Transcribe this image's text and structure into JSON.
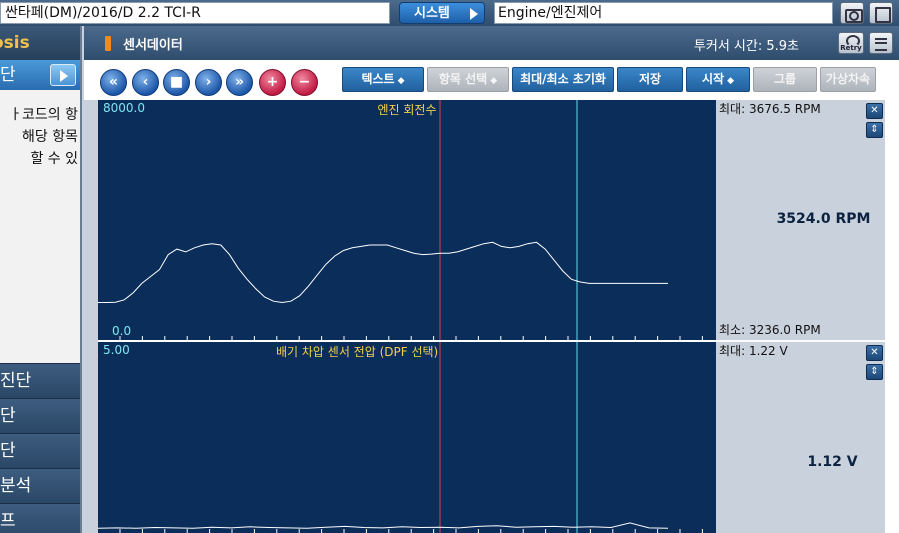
{
  "topbar": {
    "vehicle": "싼타페(DM)/2016/D 2.2 TCI-R",
    "system_button": "시스템",
    "system_field": "Engine/엔진제어"
  },
  "sidebar": {
    "title": "osis",
    "active_item": "단",
    "description": "ㅏ코드의 항\n해당 항목\n할 수 있",
    "items": [
      "진단",
      "단",
      "단",
      "분석",
      "프"
    ]
  },
  "header": {
    "title": "센서데이터",
    "trigger_time": "투커서 시간: 5.9초",
    "retry_label": "Retry"
  },
  "toolbar": {
    "text_label": "텍스트",
    "item_select_label": "항목 선택",
    "reset_minmax_label": "최대/최소 초기화",
    "save_label": "저장",
    "start_label": "시작",
    "graph_label": "그룹",
    "virtual_label": "가상차속"
  },
  "chart_data": [
    {
      "type": "line",
      "title": "엔진 회전수",
      "ylim": [
        0,
        8000
      ],
      "y_max_label": "8000.0",
      "y_min_label": "0.0",
      "x": [
        0,
        1,
        2,
        3,
        4,
        5,
        6,
        7,
        8,
        9,
        10,
        11,
        12,
        13,
        14,
        15,
        16,
        17,
        18,
        19,
        20,
        21,
        22,
        23,
        24,
        25,
        26,
        27,
        28,
        29,
        30,
        31,
        32,
        33,
        34,
        35,
        36,
        37,
        38,
        39,
        40,
        41,
        42,
        43,
        44,
        45,
        46,
        47,
        48,
        49,
        50,
        51,
        52,
        53,
        54,
        55,
        56,
        57,
        58,
        59,
        60,
        61,
        62,
        63,
        64,
        65
      ],
      "values": [
        1150,
        1150,
        1160,
        1250,
        1500,
        1850,
        2100,
        2350,
        2900,
        3100,
        3000,
        3150,
        3250,
        3300,
        3250,
        2900,
        2400,
        2000,
        1650,
        1350,
        1200,
        1150,
        1200,
        1400,
        1750,
        2150,
        2550,
        2850,
        3050,
        3150,
        3200,
        3250,
        3250,
        3250,
        3150,
        3050,
        2950,
        2900,
        2920,
        2950,
        2950,
        3000,
        3100,
        3200,
        3300,
        3350,
        3200,
        3150,
        3200,
        3300,
        3350,
        3100,
        2700,
        2300,
        2000,
        1900,
        1850,
        1850,
        1850,
        1850,
        1850,
        1850,
        1850,
        1850,
        1850,
        1850
      ],
      "stat_max": "최대: 3676.5 RPM",
      "stat_current": "3524.0 RPM",
      "stat_min": "최소: 3236.0 RPM"
    },
    {
      "type": "line",
      "title": "배기 차압 센서 전압 (DPF 선택)",
      "ylim": [
        0,
        5
      ],
      "y_max_label": "5.00",
      "x": [
        0,
        1,
        2,
        3,
        4,
        5,
        6,
        7,
        8,
        9,
        10,
        11,
        12,
        13,
        14,
        15,
        16,
        17,
        18,
        19,
        20,
        21,
        22,
        23,
        24,
        25,
        26,
        27,
        28,
        29,
        30
      ],
      "values": [
        0.05,
        0.06,
        0.05,
        0.07,
        0.06,
        0.05,
        0.08,
        0.06,
        0.09,
        0.07,
        0.06,
        0.05,
        0.08,
        0.1,
        0.07,
        0.06,
        0.09,
        0.07,
        0.08,
        0.06,
        0.1,
        0.12,
        0.08,
        0.09,
        0.1,
        0.08,
        0.09,
        0.07,
        0.2,
        0.06,
        0.05
      ],
      "stat_max": "최대:  1.22 V",
      "stat_current": "1.12 V"
    }
  ],
  "colors": {
    "plot_bg": "#0b2d5a",
    "trace": "#ffffff",
    "cursor_red": "#e0404a",
    "cursor_cyan": "#5fe0e8",
    "axis_label": "#7fe6f0",
    "chart_title": "#f0d24a"
  },
  "icons": {
    "camera": "camera-icon",
    "layout": "layout-icon",
    "retry": "retry-icon",
    "menu": "menu-icon",
    "close": "close-icon",
    "updown": "updown-icon"
  }
}
